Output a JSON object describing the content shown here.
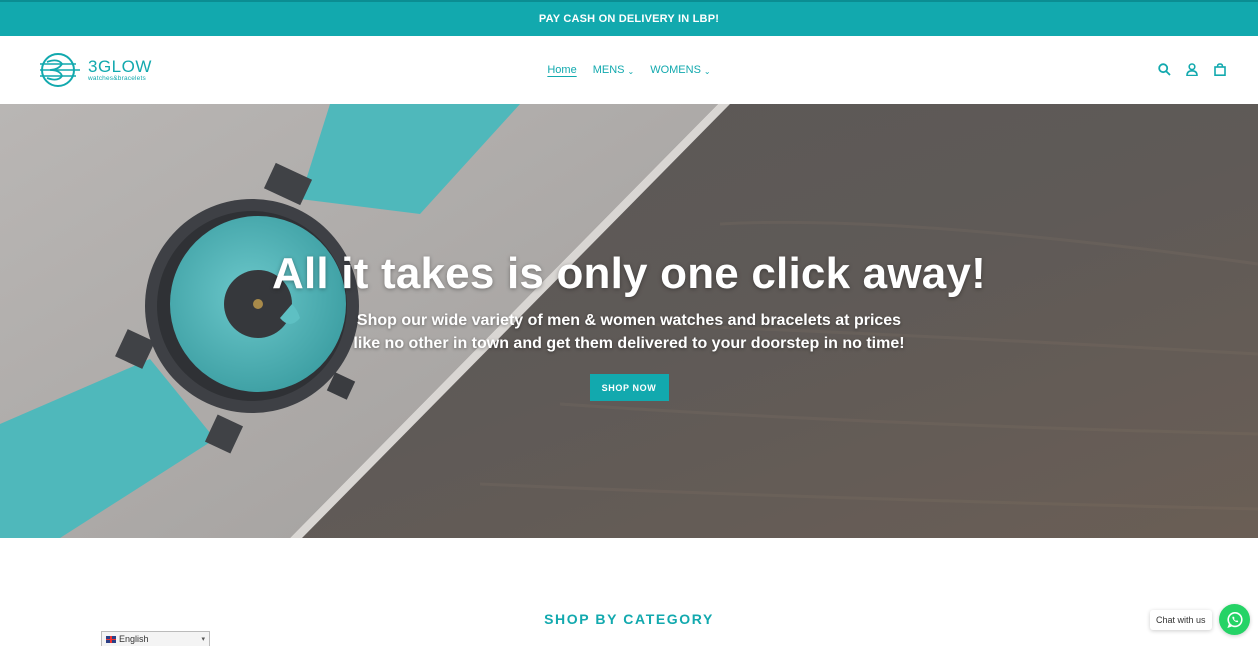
{
  "announcement": {
    "text": "PAY CASH ON DELIVERY IN LBP!"
  },
  "header": {
    "logo": {
      "brand": "3GLOW",
      "tagline": "watches&bracelets"
    },
    "nav": [
      {
        "label": "Home",
        "active": true,
        "dropdown": false
      },
      {
        "label": "MENS",
        "active": false,
        "dropdown": true
      },
      {
        "label": "WOMENS",
        "active": false,
        "dropdown": true
      }
    ],
    "icons": [
      "search-icon",
      "account-icon",
      "cart-icon"
    ]
  },
  "hero": {
    "title": "All it takes is only one click away!",
    "subtitle_line1": "Shop our wide variety of men & women watches and bracelets at prices",
    "subtitle_line2": "like no other in town and get them delivered to your doorstep in no time!",
    "button_label": "SHOP NOW"
  },
  "sections": {
    "category_title": "SHOP BY CATEGORY"
  },
  "language": {
    "selected": "English"
  },
  "chat": {
    "label": "Chat with us"
  },
  "colors": {
    "accent": "#12a9ae",
    "whatsapp": "#25d366",
    "strap": "#4fb8bb"
  }
}
